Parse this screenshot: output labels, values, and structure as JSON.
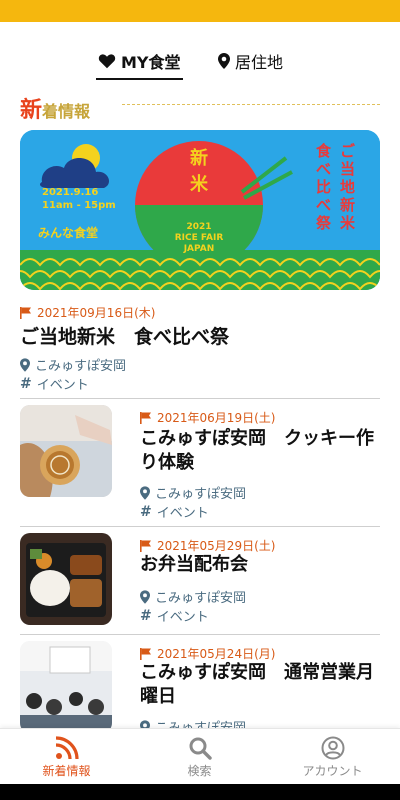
{
  "colors": {
    "accent": "#f5b70e",
    "date": "#d85a17",
    "meta": "#4a6b80",
    "active_nav": "#e0531c"
  },
  "tabs": [
    {
      "label": "MY食堂",
      "icon": "heart-icon",
      "active": true
    },
    {
      "label": "居住地",
      "icon": "map-pin-icon",
      "active": false
    }
  ],
  "section": {
    "title_first": "新",
    "title_rest": "着情報"
  },
  "banner": {
    "date": "2021.9.16",
    "time": "11am - 15pm",
    "logo_text": "みんな食堂",
    "bowl_text_1": "新",
    "bowl_text_2": "米",
    "bowl_sub_1": "2021",
    "bowl_sub_2": "RICE FAIR",
    "bowl_sub_3": "JAPAN",
    "vertical_col_1": "ご当地新米",
    "vertical_col_2": "食べ比べ祭"
  },
  "feature": {
    "date": "2021年09月16日(木)",
    "title": "ご当地新米　食べ比べ祭",
    "place": "こみゅすぽ安岡",
    "tag": "イベント"
  },
  "items": [
    {
      "date": "2021年06月19日(土)",
      "title": "こみゅすぽ安岡　クッキー作り体験",
      "place": "こみゅすぽ安岡",
      "tag": "イベント"
    },
    {
      "date": "2021年05月29日(土)",
      "title": "お弁当配布会",
      "place": "こみゅすぽ安岡",
      "tag": "イベント"
    },
    {
      "date": "2021年05月24日(月)",
      "title": "こみゅすぽ安岡　通常営業月曜日",
      "place": "こみゅすぽ安岡"
    }
  ],
  "nav": [
    {
      "label": "新着情報",
      "icon": "rss-icon",
      "active": true
    },
    {
      "label": "検索",
      "icon": "search-icon",
      "active": false
    },
    {
      "label": "アカウント",
      "icon": "account-icon",
      "active": false
    }
  ]
}
